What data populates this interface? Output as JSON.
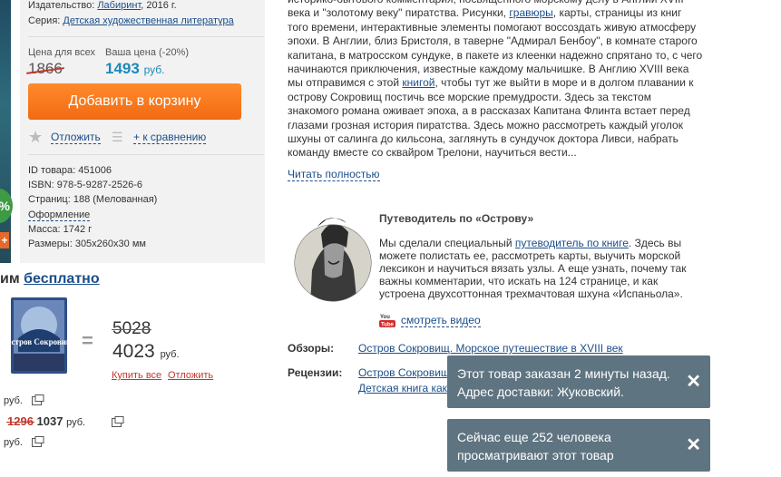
{
  "product": {
    "publisher_label": "Издательство:",
    "publisher": "Лабиринт",
    "publisher_year": ", 2016 г.",
    "series_label": "Серия:",
    "series": "Детская художественная литература",
    "price_all_label": "Цена для всех",
    "price_all": "1866",
    "price_yours_label": "Ваша цена (-20%)",
    "price_yours": "1493",
    "currency": "руб.",
    "cart_button": "Добавить в корзину",
    "postpone": "Отложить",
    "compare": "+ к сравнению",
    "id_line": "ID товара: 451006",
    "isbn_line": "ISBN: 978-5-9287-2526-6",
    "pages_line": "Страниц: 188 (Мелованная)",
    "design_link": "Оформление",
    "weight_line": "Масса: 1742 г",
    "size_line": "Размеры: 305x260x30 мм",
    "discount_badge": "%",
    "plus_badge": "+"
  },
  "description": {
    "text_before_1": "историко-бытового комментария, посвященного морскому делу в Англии XVIII века и \"золотому веку\" пиратства. Рисунки, ",
    "link_1": "гравюры",
    "text_before_2": ", карты, страницы из книг того времени, интерактивные элементы помогают воссоздать живую атмосферу эпохи. В Англии, близ Бристоля, в таверне \"Адмирал Бенбоу\", в комнате старого капитана, в матросском сундуке, в пакете из клеенки надежно спрятано то, с чего начинаются приключения, известные каждому мальчишке. В Англию XVIII века мы отправимся с этой ",
    "link_2": "книгой",
    "text_after": ", чтобы тут же выйти в море и в долгом плавании к острову Сокровищ постичь все морские премудрости. Здесь за текстом знакомого романа оживает эпоха, а в рассказах Капитана Флинта встает перед глазами грозная история пиратства. Здесь можно рассмотреть каждый уголок шхуны от салинга до кильсона, заглянуть в сундучок доктора Ливси, набрать команду вместе со сквайром Трелони, научиться вести...",
    "read_more": "Читать полностью"
  },
  "guide": {
    "title": "Путеводитель по «Острову»",
    "text_1": "Мы сделали специальный ",
    "link": "путеводитель по книге",
    "text_2": ". Здесь вы можете полистать ее, рассмотреть карты, выучить морской лексикон и научиться вязать узлы. А еще узнать, почему так важны комментарии, что искать на 124 странице, и как устроена двухсоттонная трехмачтовая шхуна «Испаньола».",
    "video": "смотреть видео",
    "yt_label": "You Tube"
  },
  "reviews": {
    "label": "Обзоры:",
    "link": "Остров Сокровищ. Морское путешествие в XVIII век"
  },
  "critiques": {
    "label": "Рецензии:",
    "link_1": "Остров Сокровищ",
    "link_2": "Детская книга как"
  },
  "bundle": {
    "heading_prefix": "им ",
    "heading_link": "бесплатно",
    "eq": "=",
    "old_total": "5028",
    "new_total": "4023",
    "currency": "руб.",
    "buy_all": "Купить все",
    "postpone": "Отложить",
    "book_title": "Остров Сокровищ",
    "row_1": "руб.",
    "row_2_old": "1296",
    "row_2_new": "1037",
    "row_2_cur": "руб.",
    "row_3": "руб."
  },
  "toasts": [
    {
      "text": "Этот товар заказан 2 минуты назад. Адрес доставки: Жуковский.",
      "close": "✕"
    },
    {
      "text": "Сейчас еще 252 человека просматривают этот товар",
      "close": "✕"
    }
  ],
  "colors": {
    "accent_orange": "#f36a12",
    "price_blue": "#1b8ab9",
    "link_blue": "#1a4e8a",
    "toast_bg": "#5f7481"
  }
}
